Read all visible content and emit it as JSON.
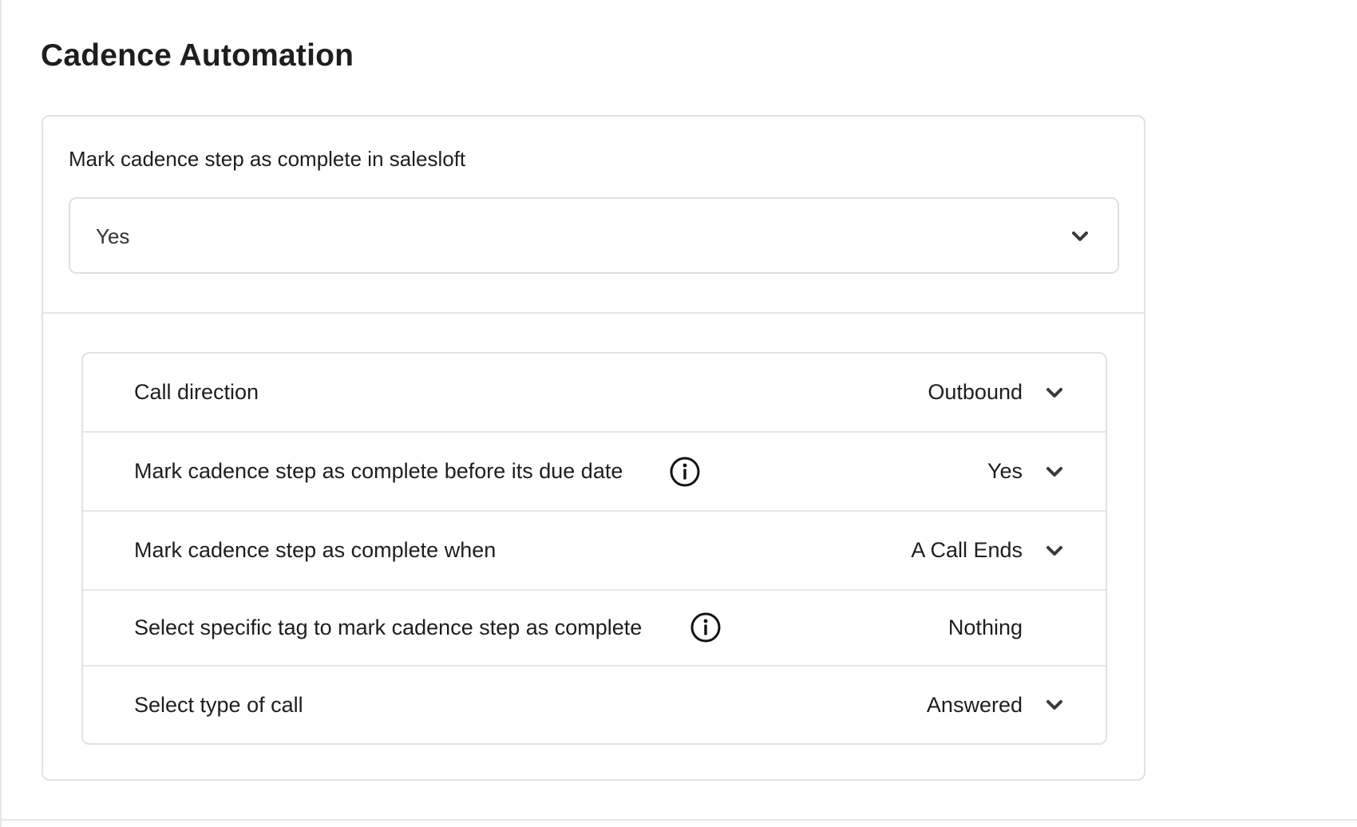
{
  "page": {
    "title": "Cadence Automation"
  },
  "primary_setting": {
    "label": "Mark cadence step as complete in salesloft",
    "selected_value": "Yes"
  },
  "settings": [
    {
      "label": "Call direction",
      "value": "Outbound",
      "has_info": false,
      "has_dropdown": true
    },
    {
      "label": "Mark cadence step as complete before its due date",
      "value": "Yes",
      "has_info": true,
      "has_dropdown": true
    },
    {
      "label": "Mark cadence step as complete when",
      "value": "A Call Ends",
      "has_info": false,
      "has_dropdown": true
    },
    {
      "label": "Select specific tag to mark cadence step as complete",
      "value": "Nothing",
      "has_info": true,
      "has_dropdown": false
    },
    {
      "label": "Select type of call",
      "value": "Answered",
      "has_info": false,
      "has_dropdown": true
    }
  ],
  "icons": {
    "dropdown": "chevron-down-icon",
    "info": "info-icon"
  },
  "colors": {
    "text": "#1e1e1e",
    "border": "#e2e2e2",
    "chevron": "#3a3a3a"
  }
}
